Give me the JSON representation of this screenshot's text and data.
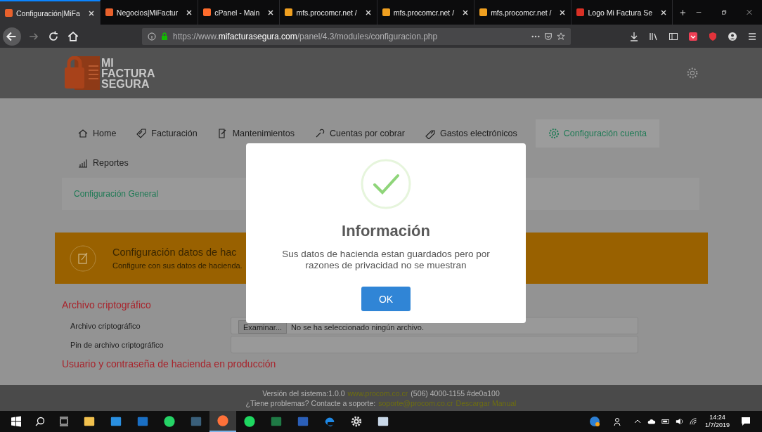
{
  "browser": {
    "tabs": [
      {
        "label": "Configuración|MiFa",
        "selected": true,
        "color": "#e8612c"
      },
      {
        "label": "Negocios|MiFactur",
        "selected": false,
        "color": "#e8612c"
      },
      {
        "label": "cPanel - Main",
        "selected": false,
        "color": "#ff6c2c"
      },
      {
        "label": "mfs.procomcr.net /",
        "selected": false,
        "color": "#f0a020"
      },
      {
        "label": "mfs.procomcr.net /",
        "selected": false,
        "color": "#f0a020"
      },
      {
        "label": "mfs.procomcr.net /",
        "selected": false,
        "color": "#f0a020"
      },
      {
        "label": "Logo Mi Factura Se",
        "selected": false,
        "color": "#d93025"
      }
    ],
    "url": {
      "scheme": "https://www.",
      "domain": "mifacturasegura.com",
      "path": "/panel/4.3/modules/configuracion.php"
    }
  },
  "header": {
    "logo": [
      "MI",
      "FACTURA",
      "SEGURA"
    ]
  },
  "nav": [
    {
      "label": "Home",
      "selected": false
    },
    {
      "label": "Facturación",
      "selected": false
    },
    {
      "label": "Mantenimientos",
      "selected": false
    },
    {
      "label": "Cuentas por cobrar",
      "selected": false
    },
    {
      "label": "Gastos electrónicos",
      "selected": false
    },
    {
      "label": "Configuración cuenta",
      "selected": true
    },
    {
      "label": "Reportes",
      "selected": false
    }
  ],
  "subnav": "Configuración General",
  "banner": {
    "title": "Configuración datos de hac",
    "subtitle": "Configure con sus datos de hacienda."
  },
  "sections": [
    {
      "title": "Archivo criptográfico",
      "fields": [
        {
          "label": "Archivo criptográfico",
          "kind": "file",
          "button": "Examinar...",
          "value": "No se ha seleccionado ningún archivo."
        },
        {
          "label": "Pin de archivo criptográfico",
          "kind": "text"
        }
      ]
    },
    {
      "title": "Usuario y contraseña de hacienda en producción"
    }
  ],
  "footer": {
    "line1": [
      {
        "text": "Versión del sistema:1.0.0",
        "link": false
      },
      {
        "text": "www.procom.co.cr",
        "link": true
      },
      {
        "text": "(506) 4000-1155 #de0a100",
        "link": false
      }
    ],
    "line2": [
      {
        "text": "¿Tiene problemas? Contacte a soporte:",
        "link": false
      },
      {
        "text": "soporte@procom.co.cr",
        "link": true
      },
      {
        "text": "Descargar Manual",
        "link": true
      }
    ]
  },
  "dialog": {
    "title": "Información",
    "message": "Sus datos de hacienda estan guardados pero por razones de privacidad no se muestran",
    "button": "OK"
  },
  "taskbar": {
    "apps": [
      {
        "kind": "folder",
        "selected": false
      },
      {
        "kind": "code",
        "selected": false
      },
      {
        "kind": "mail",
        "selected": false
      },
      {
        "kind": "chat",
        "selected": false
      },
      {
        "kind": "graph",
        "selected": false
      },
      {
        "kind": "browser",
        "selected": true
      },
      {
        "kind": "music",
        "selected": false
      },
      {
        "kind": "sheet",
        "selected": false
      },
      {
        "kind": "doc",
        "selected": false
      },
      {
        "kind": "edge",
        "selected": false
      },
      {
        "kind": "gear",
        "selected": false
      },
      {
        "kind": "paint",
        "selected": false
      }
    ],
    "time": "14:24",
    "date": "1/7/2019"
  }
}
